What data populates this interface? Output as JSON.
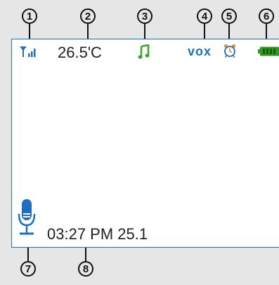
{
  "callouts": [
    "1",
    "2",
    "3",
    "4",
    "5",
    "6",
    "7",
    "8"
  ],
  "status_bar": {
    "signal_icon": "signal-icon",
    "temperature": "26.5'C",
    "music_icon": "music-note-icon",
    "vox_label": "vox",
    "alarm_icon": "alarm-clock-icon",
    "battery_icon": "battery-icon"
  },
  "bottom_bar": {
    "mic_icon": "microphone-icon",
    "time_readout": "03:27 PM 25.1"
  },
  "colors": {
    "accent_blue": "#1e6fc2",
    "music_green": "#3aa32e",
    "battery_green": "#2f9a22",
    "alarm_orange": "#e38b22"
  }
}
